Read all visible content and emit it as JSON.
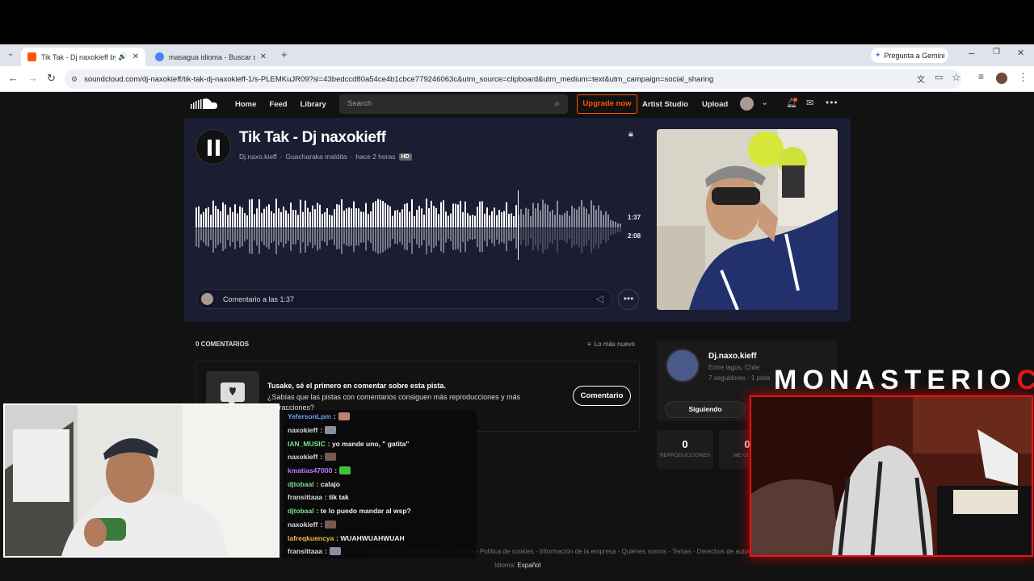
{
  "browser": {
    "tabs": [
      {
        "title": "Tik Tak - Dj naxokieff by Dj.n",
        "active": true,
        "favicon_color": "#ff5500"
      },
      {
        "title": "masagua idioma - Buscar con G",
        "active": false,
        "favicon_color": "#4285f4"
      }
    ],
    "gemini_label": "Pregunta a Gemini",
    "url": "soundcloud.com/dj-naxokieff/tik-tak-dj-naxokieff-1/s-PLEMKuJR09?si=43bedccd80a54ce4b1cbce779246063c&utm_source=clipboard&utm_medium=text&utm_campaign=social_sharing"
  },
  "nav": {
    "links": [
      "Home",
      "Feed",
      "Library"
    ],
    "search_placeholder": "Search",
    "upgrade": "Upgrade now",
    "right_links": [
      "Artist Studio",
      "Upload"
    ]
  },
  "track": {
    "title": "Tik Tak - Dj naxokieff",
    "artist": "Dj.naxo.kieff",
    "album": "Guacharaka maldita",
    "posted": "hace 2 horas",
    "quality": "HD",
    "current_time": "1:37",
    "duration": "2:08",
    "progress": 0.758,
    "comment_placeholder": "Comentario a las 1:37"
  },
  "comments": {
    "count_label": "0 COMENTARIOS",
    "sort_label": "Lo más nuevo",
    "empty_title": "Tusake, sé el primero en comentar sobre esta pista.",
    "empty_sub": "¿Sabías que las pistas con comentarios consiguen más reproducciones y más interacciones?",
    "button": "Comentario"
  },
  "artist_card": {
    "name": "Dj.naxo.kieff",
    "location": "Entre lagos, Chile",
    "followers": "7 seguidores",
    "tracks": "1 pista",
    "follow_button": "Siguiendo"
  },
  "stats": [
    {
      "value": "0",
      "label": "REPRODUCCIONES"
    },
    {
      "value": "0",
      "label": "ME GUSTA"
    }
  ],
  "footer": {
    "links": "Privacidad  -  Administrador de cookies  -  Política de cookies  -  Información de la empresa  -  Quiénes somos  -  Temas  -  Derechos de autor",
    "language_label": "Idioma:",
    "language": "Español"
  },
  "stream": {
    "title_main": "MONASTERIO",
    "title_accent": "CL",
    "chat": [
      {
        "user": "YefersonLpm",
        "color": "#6aa0ff",
        "text": ":",
        "emote": "#c08070"
      },
      {
        "user": "naxokieff",
        "color": "#dddddd",
        "text": ":",
        "emote": "#8890a0"
      },
      {
        "user": "IAN_MUSIC",
        "color": "#7ee08a",
        "text": ": yo mande uno, \" gatita\"",
        "emote": ""
      },
      {
        "user": "naxokieff",
        "color": "#dddddd",
        "text": ":",
        "emote": "#7a5a50"
      },
      {
        "user": "kmatias47000",
        "color": "#b87cff",
        "text": ":",
        "emote": "#40c040"
      },
      {
        "user": "djtobaal",
        "color": "#7ee08a",
        "text": ": calajo",
        "emote": ""
      },
      {
        "user": "fransittaaa",
        "color": "#dddddd",
        "text": ": tik tak",
        "emote": ""
      },
      {
        "user": "djtobaal",
        "color": "#7ee08a",
        "text": ": te lo puedo mandar al wsp?",
        "emote": ""
      },
      {
        "user": "naxokieff",
        "color": "#dddddd",
        "text": ":",
        "emote": "#7a5a50"
      },
      {
        "user": "lafreqkuencya",
        "color": "#f0c040",
        "text": ": WUAHWUAHWUAH",
        "emote": ""
      },
      {
        "user": "fransittaaa",
        "color": "#dddddd",
        "text": ":",
        "emote": "#8890a0"
      }
    ]
  }
}
